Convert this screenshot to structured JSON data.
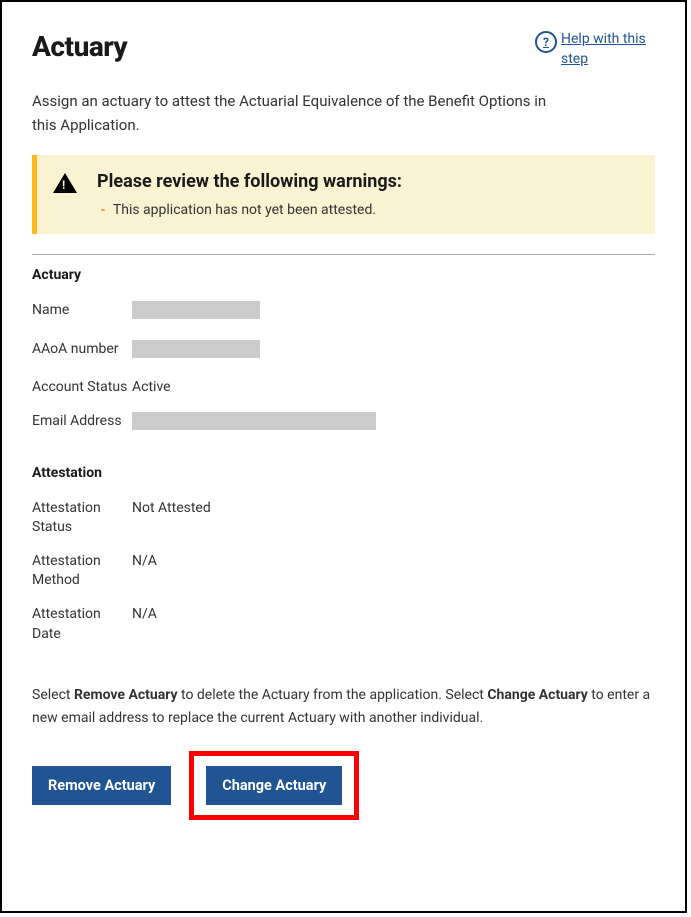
{
  "header": {
    "title": "Actuary",
    "helpLink": "Help with this step"
  },
  "intro": "Assign an actuary to attest the Actuarial Equivalence of the Benefit Options in this Application.",
  "warning": {
    "title": "Please review the following warnings:",
    "item": "This application has not yet been attested."
  },
  "actuarySection": {
    "heading": "Actuary",
    "fields": {
      "nameLabel": "Name",
      "aaoaLabel": "AAoA number",
      "accountStatusLabel": "Account Status",
      "accountStatusValue": "Active",
      "emailLabel": "Email Address"
    }
  },
  "attestationSection": {
    "heading": "Attestation",
    "fields": {
      "statusLabel": "Attestation Status",
      "statusValue": "Not Attested",
      "methodLabel": "Attestation Method",
      "methodValue": "N/A",
      "dateLabel": "Attestation Date",
      "dateValue": "N/A"
    }
  },
  "instructions": {
    "pre1": "Select ",
    "bold1": "Remove Actuary",
    "mid1": " to delete the Actuary from the application. Select ",
    "bold2": "Change Actuary",
    "post1": " to enter a new email address to replace the current Actuary with another individual."
  },
  "buttons": {
    "remove": "Remove Actuary",
    "change": "Change Actuary"
  }
}
